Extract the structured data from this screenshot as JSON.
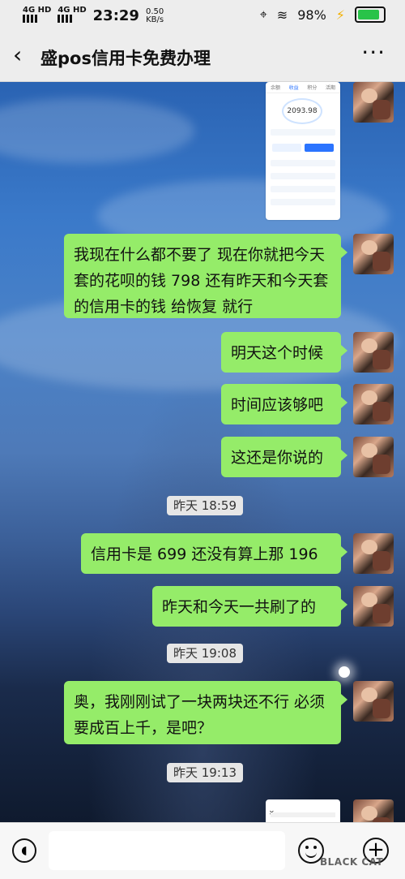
{
  "status_bar": {
    "network_1": "4G HD",
    "network_2": "4G HD",
    "time": "23:29",
    "speed": "0.50",
    "speed_unit": "KB/s",
    "battery_percent": "98%"
  },
  "nav": {
    "back_icon": "chevron-left-icon",
    "title": "盛pos信用卡免费办理",
    "more_icon": "more-icon"
  },
  "screenshot_card": {
    "tabs": [
      "余额",
      "收益",
      "积分",
      "活期"
    ],
    "balance": "2093.98"
  },
  "messages": [
    {
      "type": "text",
      "from": "me",
      "text": "我现在什么都不要了 现在你就把今天套的花呗的钱 798 还有昨天和今天套的信用卡的钱 给恢复 就行"
    },
    {
      "type": "text",
      "from": "me",
      "text": "明天这个时候"
    },
    {
      "type": "text",
      "from": "me",
      "text": "时间应该够吧"
    },
    {
      "type": "text",
      "from": "me",
      "text": "这还是你说的"
    },
    {
      "type": "timestamp",
      "text": "昨天 18:59"
    },
    {
      "type": "text",
      "from": "me",
      "text": "信用卡是 699 还没有算上那 196"
    },
    {
      "type": "text",
      "from": "me",
      "text": "昨天和今天一共刷了的"
    },
    {
      "type": "timestamp",
      "text": "昨天 19:08"
    },
    {
      "type": "text",
      "from": "me",
      "text": "奥，我刚刚试了一块两块还不行 必须要成百上千，是吧？"
    },
    {
      "type": "timestamp",
      "text": "昨天 19:13"
    }
  ],
  "input_bar": {
    "voice_icon": "voice-icon",
    "emoji_icon": "emoji-icon",
    "plus_icon": "plus-icon"
  },
  "watermark": "BLACK CAT"
}
